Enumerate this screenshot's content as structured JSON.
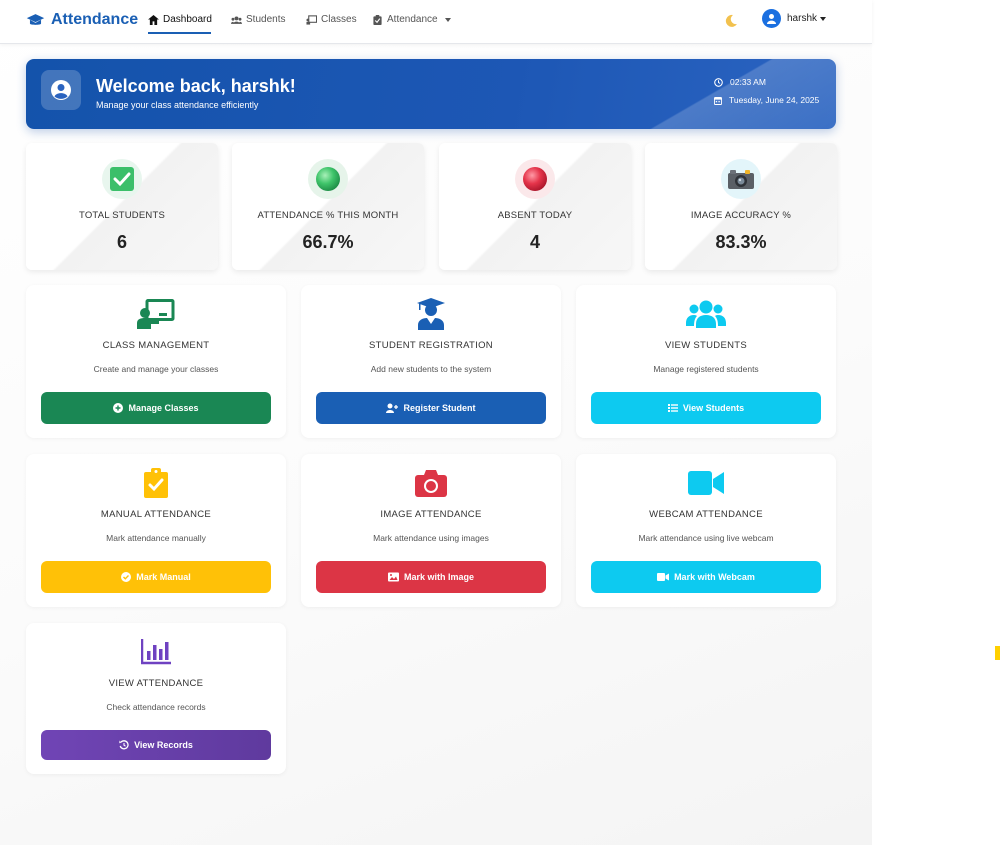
{
  "navbar": {
    "brand": "Attendance",
    "items": [
      {
        "label": "Dashboard",
        "icon": "home-icon"
      },
      {
        "label": "Students",
        "icon": "users-icon"
      },
      {
        "label": "Classes",
        "icon": "chalkboard-icon"
      },
      {
        "label": "Attendance",
        "icon": "clipboard-icon"
      }
    ],
    "user": "harshk"
  },
  "welcome": {
    "title": "Welcome back, harshk!",
    "subtitle": "Manage your class attendance efficiently",
    "time": "02:33 AM",
    "date": "Tuesday, June 24, 2025"
  },
  "stats": [
    {
      "label": "TOTAL STUDENTS",
      "value": "6",
      "icon": "check-box-icon"
    },
    {
      "label": "ATTENDANCE % THIS MONTH",
      "value": "66.7%",
      "icon": "green-circle-icon"
    },
    {
      "label": "ABSENT TODAY",
      "value": "4",
      "icon": "red-circle-icon"
    },
    {
      "label": "IMAGE ACCURACY %",
      "value": "83.3%",
      "icon": "camera-icon"
    }
  ],
  "cards": [
    {
      "title": "CLASS MANAGEMENT",
      "desc": "Create and manage your classes",
      "button": "Manage Classes",
      "color": "#1a8754"
    },
    {
      "title": "STUDENT REGISTRATION",
      "desc": "Add new students to the system",
      "button": "Register Student",
      "color": "#1a5fb4"
    },
    {
      "title": "VIEW STUDENTS",
      "desc": "Manage registered students",
      "button": "View Students",
      "color": "#0dcaf0"
    },
    {
      "title": "MANUAL ATTENDANCE",
      "desc": "Mark attendance manually",
      "button": "Mark Manual",
      "color": "#ffc107"
    },
    {
      "title": "IMAGE ATTENDANCE",
      "desc": "Mark attendance using images",
      "button": "Mark with Image",
      "color": "#dc3545"
    },
    {
      "title": "WEBCAM ATTENDANCE",
      "desc": "Mark attendance using live webcam",
      "button": "Mark with Webcam",
      "color": "#0dcaf0"
    },
    {
      "title": "VIEW ATTENDANCE",
      "desc": "Check attendance records",
      "button": "View Records",
      "color": "#6f42c1"
    }
  ]
}
